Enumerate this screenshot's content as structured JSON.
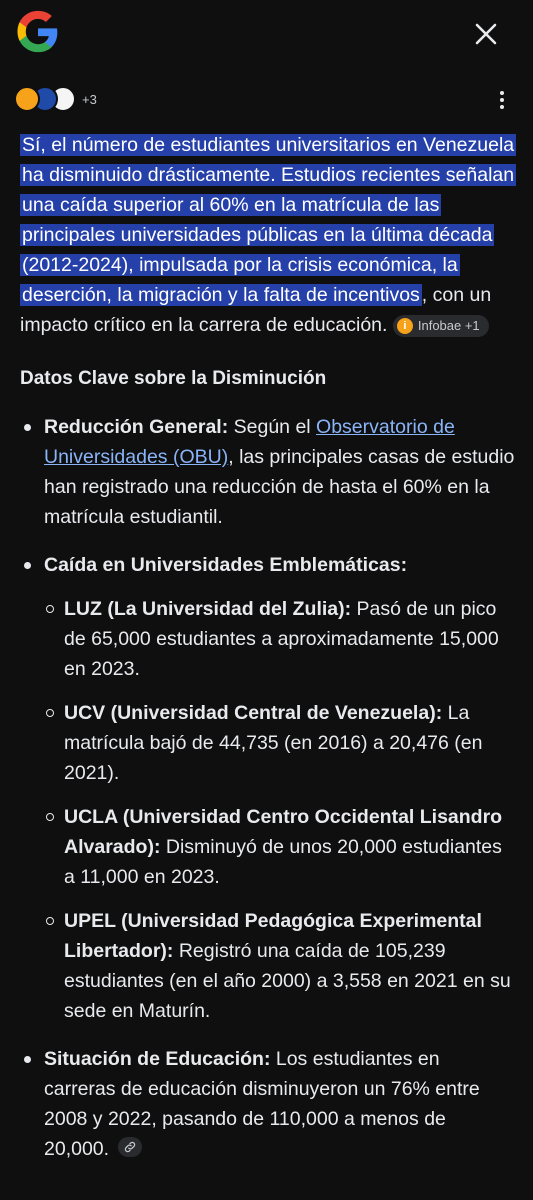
{
  "header": {
    "sources_count": "+3"
  },
  "summary": {
    "highlighted": "Sí, el número de estudiantes universitarios en Venezuela ha disminuido drásticamente. Estudios recientes señalan una caída superior al 60% en la matrícula de las principales universidades públicas en la última década (2012-2024), impulsada por la crisis económica, la deserción, la migración y la falta de incentivos",
    "rest": ", con un impacto crítico en la carrera de educación.",
    "chip_label": "Infobae +1"
  },
  "section": {
    "heading": "Datos Clave sobre la Disminución",
    "item1": {
      "label": "Reducción General:",
      "pre": " Según el ",
      "link": "Observatorio de Universidades (OBU)",
      "post": ", las principales casas de estudio han registrado una reducción de hasta el 60% en la matrícula estudiantil."
    },
    "item2": {
      "label": "Caída en Universidades Emblemáticas:",
      "subitems": [
        {
          "label": "LUZ (La Universidad del Zulia):",
          "text": " Pasó de un pico de 65,000 estudiantes a aproximadamente 15,000 en 2023."
        },
        {
          "label": "UCV (Universidad Central de Venezuela):",
          "text": " La matrícula bajó de 44,735 (en 2016) a 20,476 (en 2021)."
        },
        {
          "label": "UCLA (Universidad Centro Occidental Lisandro Alvarado):",
          "text": " Disminuyó de unos 20,000 estudiantes a 11,000 en 2023."
        },
        {
          "label": "UPEL (Universidad Pedagógica Experimental Libertador):",
          "text": " Registró una caída de 105,239 estudiantes (en el año 2000) a 3,558 en 2021 en su sede en Maturín."
        }
      ]
    },
    "item3": {
      "label": "Situación de Educación:",
      "text": " Los estudiantes en carreras de educación disminuyeron un 76% entre 2008 y 2022, pasando de 110,000 a menos de 20,000."
    }
  },
  "icons": {
    "logo": "google-g-logo",
    "close": "close-icon",
    "more": "more-vert-icon",
    "link": "link-icon"
  }
}
